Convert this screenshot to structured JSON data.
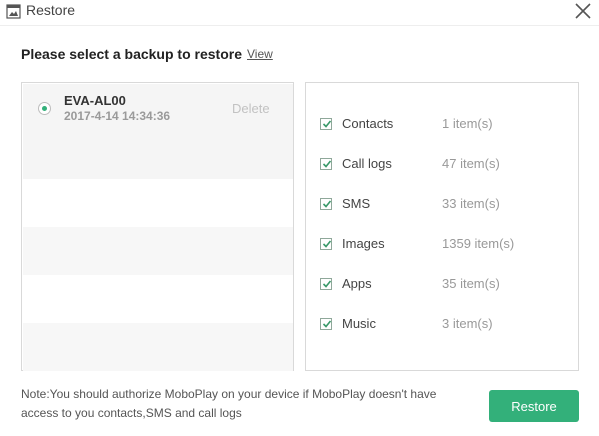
{
  "window": {
    "title": "Restore",
    "icon": "restore-app-icon",
    "close_icon": "close-icon"
  },
  "heading": {
    "text": "Please select a backup to restore",
    "view_link": "View"
  },
  "backups": [
    {
      "name": "EVA-AL00",
      "date": "2017-4-14 14:34:36",
      "delete_label": "Delete",
      "selected": true
    }
  ],
  "categories": [
    {
      "label": "Contacts",
      "count": "1 item(s)",
      "checked": true
    },
    {
      "label": "Call logs",
      "count": "47 item(s)",
      "checked": true
    },
    {
      "label": "SMS",
      "count": "33 item(s)",
      "checked": true
    },
    {
      "label": "Images",
      "count": "1359 item(s)",
      "checked": true
    },
    {
      "label": "Apps",
      "count": "35 item(s)",
      "checked": true
    },
    {
      "label": "Music",
      "count": "3 item(s)",
      "checked": true
    }
  ],
  "note": "Note:You should authorize MoboPlay on your device if MoboPlay doesn't have access to you contacts,SMS and call logs",
  "restore_button": "Restore",
  "colors": {
    "accent": "#33b07a",
    "check": "#3a9a6a",
    "border": "#d9d9d9"
  }
}
